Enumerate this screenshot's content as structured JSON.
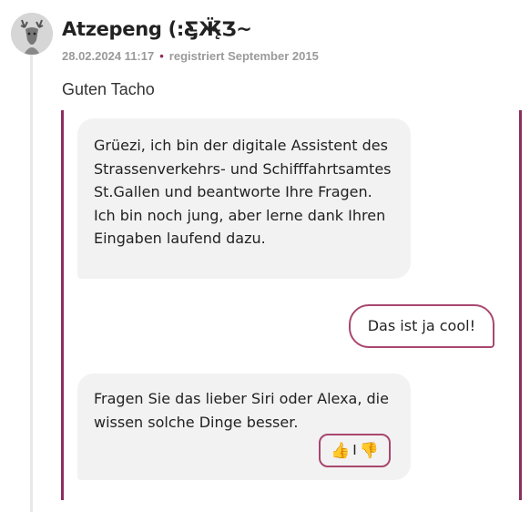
{
  "post": {
    "username": "Atzepeng (:Ƹ̵̡Ӝ̵̨̄Ʒ~",
    "date": "28.02.2024 11:17",
    "dot": "•",
    "registered": "registriert September 2015",
    "text": "Guten Tacho"
  },
  "chat": {
    "messages": [
      {
        "sender": "bot",
        "text": "Grüezi, ich bin der digitale Assistent des Strassenverkehrs- und Schifffahrtsamtes St.Gallen und beantworte Ihre Fragen. Ich bin noch jung, aber lerne dank Ihren Eingaben laufend dazu."
      },
      {
        "sender": "user",
        "text": "Das ist ja cool!"
      },
      {
        "sender": "bot",
        "text": "Fragen Sie das lieber Siri oder Alexa, die wissen solche Dinge besser."
      }
    ],
    "feedback": {
      "up": "👍",
      "separator": "I",
      "down": "👎"
    }
  },
  "colors": {
    "accent": "#8b2f5c",
    "bubble": "#f2f2f2",
    "meta": "#9a9a9a"
  }
}
